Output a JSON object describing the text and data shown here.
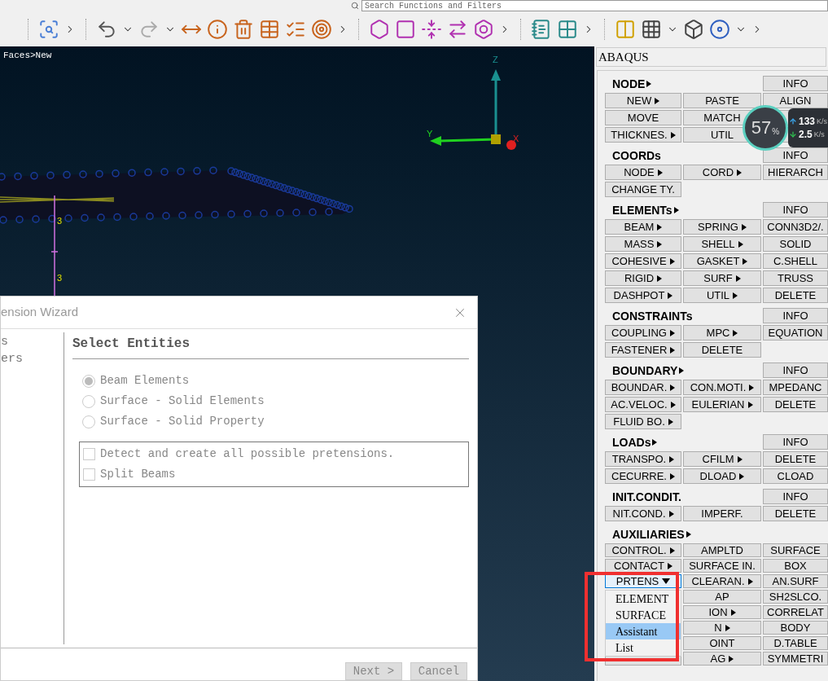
{
  "toolbar": {
    "search": {
      "placeholder": "Search Functions and Filters"
    }
  },
  "viewport": {
    "breadcrumb": "Faces>New",
    "axes": {
      "z": "Z",
      "y": "Y",
      "x": "X"
    },
    "node_labels": [
      "3",
      "3"
    ]
  },
  "speed_widget": {
    "percent": "57",
    "percent_unit": "%",
    "upload": "133",
    "upload_unit": "K/s",
    "download": "2.5",
    "download_unit": "K/s"
  },
  "dialog": {
    "title": "ension Wizard",
    "steps": [
      "s",
      "ers"
    ],
    "heading": "Select Entities",
    "radios": [
      {
        "label": "Beam Elements",
        "selected": true,
        "disabled": true
      },
      {
        "label": "Surface - Solid Elements",
        "selected": false,
        "disabled": true
      },
      {
        "label": "Surface - Solid Property",
        "selected": false,
        "disabled": true
      }
    ],
    "checkboxes": [
      {
        "label": "Detect and create all possible pretensions.",
        "checked": false,
        "disabled": true
      },
      {
        "label": "Split Beams",
        "checked": false,
        "disabled": true
      }
    ],
    "buttons": [
      {
        "label": "Next >",
        "disabled": true
      },
      {
        "label": "Cancel",
        "disabled": true
      }
    ]
  },
  "panel": {
    "title": "ABAQUS",
    "sections": [
      {
        "title": "NODE",
        "arrow": true,
        "info": "INFO",
        "rows": [
          [
            {
              "label": "NEW",
              "arrow": true
            },
            {
              "label": "PASTE"
            },
            {
              "label": "ALIGN"
            }
          ],
          [
            {
              "label": "MOVE"
            },
            {
              "label": "MATCH"
            },
            {}
          ],
          [
            {
              "label": "THICKNES.",
              "arrow": true
            },
            {
              "label": "UTIL"
            },
            {}
          ]
        ]
      },
      {
        "title": "COORDs",
        "arrow": false,
        "info": "INFO",
        "rows": [
          [
            {
              "label": "NODE",
              "arrow": true
            },
            {
              "label": "CORD",
              "arrow": true
            },
            {
              "label": "HIERARCH"
            }
          ],
          [
            {
              "label": "CHANGE TY."
            }
          ]
        ]
      },
      {
        "title": "ELEMENTs",
        "arrow": true,
        "info": "INFO",
        "rows": [
          [
            {
              "label": "BEAM",
              "arrow": true
            },
            {
              "label": "SPRING",
              "arrow": true
            },
            {
              "label": "CONN3D2/."
            }
          ],
          [
            {
              "label": "MASS",
              "arrow": true
            },
            {
              "label": "SHELL",
              "arrow": true
            },
            {
              "label": "SOLID"
            }
          ],
          [
            {
              "label": "COHESIVE",
              "arrow": true
            },
            {
              "label": "GASKET",
              "arrow": true
            },
            {
              "label": "C.SHELL"
            }
          ],
          [
            {
              "label": "RIGID",
              "arrow": true
            },
            {
              "label": "SURF",
              "arrow": true
            },
            {
              "label": "TRUSS"
            }
          ],
          [
            {
              "label": "DASHPOT",
              "arrow": true
            },
            {
              "label": "UTIL",
              "arrow": true
            },
            {
              "label": "DELETE"
            }
          ]
        ]
      },
      {
        "title": "CONSTRAINTs",
        "arrow": false,
        "info": "INFO",
        "rows": [
          [
            {
              "label": "COUPLING",
              "arrow": true
            },
            {
              "label": "MPC",
              "arrow": true
            },
            {
              "label": "EQUATION"
            }
          ],
          [
            {
              "label": "FASTENER",
              "arrow": true
            },
            {
              "label": "DELETE"
            }
          ]
        ]
      },
      {
        "title": "BOUNDARY",
        "arrow": true,
        "info": "INFO",
        "rows": [
          [
            {
              "label": "BOUNDAR.",
              "arrow": true
            },
            {
              "label": "CON.MOTI.",
              "arrow": true
            },
            {
              "label": "MPEDANC"
            }
          ],
          [
            {
              "label": "AC.VELOC.",
              "arrow": true
            },
            {
              "label": "EULERIAN",
              "arrow": true
            },
            {
              "label": "DELETE"
            }
          ],
          [
            {
              "label": "FLUID BO.",
              "arrow": true
            }
          ]
        ]
      },
      {
        "title": "LOADs",
        "arrow": true,
        "info": "INFO",
        "rows": [
          [
            {
              "label": "TRANSPO.",
              "arrow": true
            },
            {
              "label": "CFILM",
              "arrow": true
            },
            {
              "label": "DELETE"
            }
          ],
          [
            {
              "label": "CECURRE.",
              "arrow": true
            },
            {
              "label": "DLOAD",
              "arrow": true
            },
            {
              "label": "CLOAD"
            }
          ]
        ]
      },
      {
        "title": "INIT.CONDIT.",
        "arrow": false,
        "info": "INFO",
        "rows": [
          [
            {
              "label": "NIT.COND.",
              "arrow": true
            },
            {
              "label": "IMPERF."
            },
            {
              "label": "DELETE"
            }
          ]
        ]
      },
      {
        "title": "AUXILIARIES",
        "arrow": true,
        "rows": [
          [
            {
              "label": "CONTROL.",
              "arrow": true
            },
            {
              "label": "AMPLTD"
            },
            {
              "label": "SURFACE"
            }
          ],
          [
            {
              "label": "CONTACT",
              "arrow": true
            },
            {
              "label": "SURFACE IN."
            },
            {
              "label": "BOX"
            }
          ],
          [
            {
              "label": "PRTENS",
              "arrow": true,
              "open": true
            },
            {
              "label": "CLEARAN.",
              "arrow": true
            },
            {
              "label": "AN.SURF"
            }
          ],
          [
            {},
            {
              "label": "AP"
            },
            {
              "label": "SH2SLCO."
            }
          ],
          [
            {},
            {
              "label": "ION",
              "arrow": true
            },
            {
              "label": "CORRELAT"
            }
          ],
          [
            {},
            {
              "label": "N",
              "arrow": true
            },
            {
              "label": "BODY"
            }
          ],
          [
            {},
            {
              "label": "OINT"
            },
            {
              "label": "D.TABLE"
            }
          ],
          [
            {},
            {
              "label": "AG",
              "arrow": true
            },
            {
              "label": "SYMMETRI"
            }
          ]
        ]
      }
    ]
  },
  "dropdown_menu": {
    "items": [
      {
        "label": "ELEMENT",
        "selected": false
      },
      {
        "label": "SURFACE",
        "selected": false
      },
      {
        "label": "Assistant",
        "selected": true
      },
      {
        "label": "List",
        "selected": false
      }
    ]
  }
}
